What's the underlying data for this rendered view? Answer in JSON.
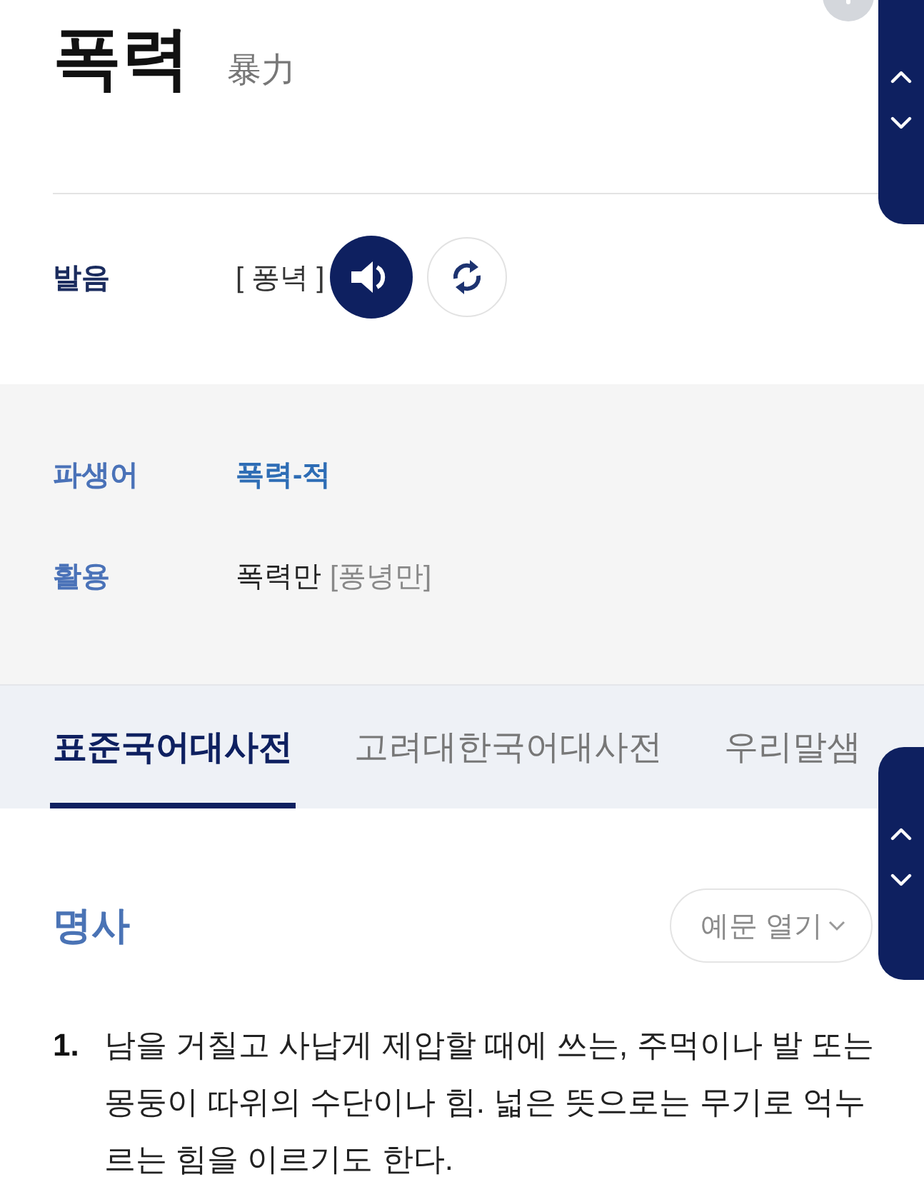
{
  "entry": {
    "headword": "폭력",
    "hanja": "暴力"
  },
  "pronunciation": {
    "label": "발음",
    "value": "[ 퐁녁 ]"
  },
  "details": [
    {
      "label": "파생어",
      "kind": "link",
      "value": "폭력-적"
    },
    {
      "label": "활용",
      "kind": "form",
      "value": "폭력만",
      "pronunciation": "[퐁녕만]"
    }
  ],
  "tabs": [
    {
      "label": "표준국어대사전",
      "selected": true
    },
    {
      "label": "고려대한국어대사전",
      "selected": false
    },
    {
      "label": "우리말샘",
      "selected": false
    }
  ],
  "sense_header": {
    "part_of_speech": "명사",
    "examples_button": "예문 열기"
  },
  "definitions": [
    {
      "number": "1.",
      "text": "남을 거칠고 사납게 제압할 때에 쓰는, 주먹이나 발 또는 몽둥이 따위의 수단이나 힘. 넓은 뜻으로는 무기로 억누르는 힘을 이르기도 한다."
    }
  ]
}
